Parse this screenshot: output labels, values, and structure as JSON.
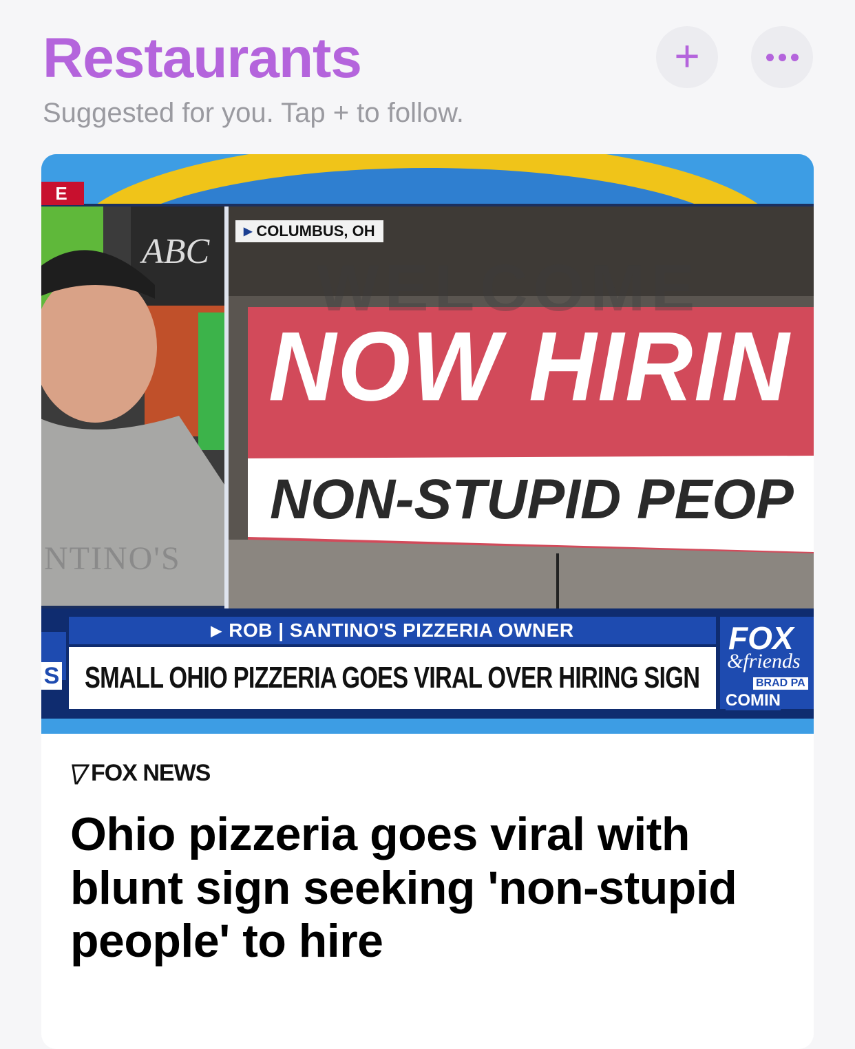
{
  "header": {
    "title": "Restaurants",
    "subtitle": "Suggested for you. Tap + to follow.",
    "add_button": "+",
    "more_button_icon": "ellipsis-icon"
  },
  "colors": {
    "accent": "#b464dc",
    "chip_background": "#ececf0",
    "card_background": "#ffffff",
    "page_background": "#f6f6f8"
  },
  "article": {
    "media": {
      "live_tag": "E",
      "location": "COLUMBUS, OH",
      "storefront_text": "ABC",
      "shirt_text": "NTINO'S",
      "background_sign": "WELCOME",
      "banner_line1": "NOW HIRIN",
      "banner_line2": "NON-STUPID PEOP",
      "lower_third_name": "ROB | SANTINO'S PIZZERIA OWNER",
      "lower_third_headline": "SMALL OHIO PIZZERIA GOES VIRAL OVER HIRING SIGN",
      "left_strip_letter": "S",
      "network_logo": "FOX",
      "network_show": "&friends",
      "network_brad": "BRAD PA",
      "network_coming": "COMIN"
    },
    "source": "FOX NEWS",
    "headline": "Ohio pizzeria goes viral with blunt sign seeking 'non-stupid people' to hire"
  }
}
